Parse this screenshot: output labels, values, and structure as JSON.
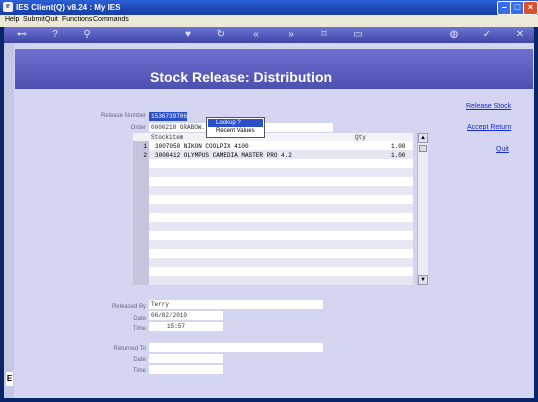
{
  "window": {
    "title": "IES Client(Q) v8.24 : My IES"
  },
  "menu": [
    {
      "label": "Help"
    },
    {
      "label": "Submit"
    },
    {
      "label": "Quit"
    },
    {
      "label": "Functions"
    },
    {
      "label": "Commands"
    }
  ],
  "toolbar_icons": [
    "key-icon",
    "help-icon",
    "search-icon",
    "heart-icon",
    "refresh-icon",
    "rewind-icon",
    "fast-forward-icon",
    "trash-icon",
    "page-icon",
    "globe-icon",
    "check-icon",
    "close-icon"
  ],
  "page": {
    "title": "Stock Release: Distribution"
  },
  "side_links": {
    "release_stock": "Release Stock",
    "accept_return": "Accept Return",
    "quit": "Quit"
  },
  "form": {
    "release_number_label": "Release Number",
    "release_number_value": "1536739706",
    "order_label": "Order",
    "order_value": "0000218 GRABOW..."
  },
  "popup": {
    "lookup": "Lookup ?",
    "recent": "Recent Values"
  },
  "grid": {
    "columns": {
      "stockitem": "Stockitem",
      "qty": "Qty"
    },
    "rows": [
      {
        "num": "1",
        "item": "3007058 NIKON COOLPIX 4100",
        "qty": "1.00"
      },
      {
        "num": "2",
        "item": "3008412 OLYMPUS CAMEDIA MASTER PRO 4.2",
        "qty": "1.00"
      }
    ]
  },
  "released": {
    "by_label": "Released By",
    "by_value": "Terry",
    "date_label": "Date",
    "date_value": "06/02/2010",
    "time_label": "Time",
    "time_value": "15:57"
  },
  "returned": {
    "to_label": "Returned To",
    "to_value": "",
    "date_label": "Date",
    "date_value": "",
    "time_label": "Time",
    "time_value": ""
  },
  "colors": {
    "banner": "#5a5dc0",
    "client_bg": "#d4d5f0",
    "link": "#1a2bd3",
    "selection": "#2c4ec9"
  }
}
